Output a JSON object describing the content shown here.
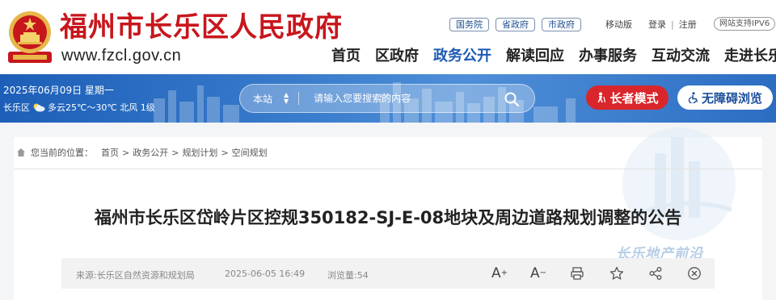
{
  "header": {
    "title": "福州市长乐区人民政府",
    "url": "www.fzcl.gov.cn",
    "top_links": {
      "gov_links": [
        "国务院",
        "省政府",
        "市政府"
      ],
      "mobile": "移动版",
      "login": "登录",
      "register": "注册",
      "ipv6": "网站支持IPV6"
    },
    "nav": [
      {
        "label": "首页",
        "active": false
      },
      {
        "label": "区政府",
        "active": false
      },
      {
        "label": "政务公开",
        "active": true
      },
      {
        "label": "解读回应",
        "active": false
      },
      {
        "label": "办事服务",
        "active": false
      },
      {
        "label": "互动交流",
        "active": false
      },
      {
        "label": "走进长乐",
        "active": false
      }
    ]
  },
  "banner": {
    "date": "2025年06月09日 星期一",
    "district": "长乐区",
    "weather": "多云25℃～30℃ 北风 1级",
    "search": {
      "scope": "本站",
      "placeholder": "请输入您要搜索的内容"
    },
    "elder_mode": "长者模式",
    "accessibility": "无障碍浏览"
  },
  "breadcrumb": {
    "prefix": "您当前的位置：",
    "items": [
      "首页",
      "政务公开",
      "规划计划",
      "空间规划"
    ]
  },
  "article": {
    "title": "福州市长乐区岱岭片区控规350182-SJ-E-08地块及周边道路规划调整的公告",
    "source": "来源:长乐区自然资源和规划局",
    "date": "2025-06-05 16:49",
    "views": "浏览量:54"
  },
  "watermark": {
    "text": "长乐地产前沿"
  },
  "colors": {
    "title_red": "#c8161d",
    "nav_active": "#1b59b3",
    "banner_blue": "#2c6dc2",
    "elder_red": "#d9262b"
  }
}
